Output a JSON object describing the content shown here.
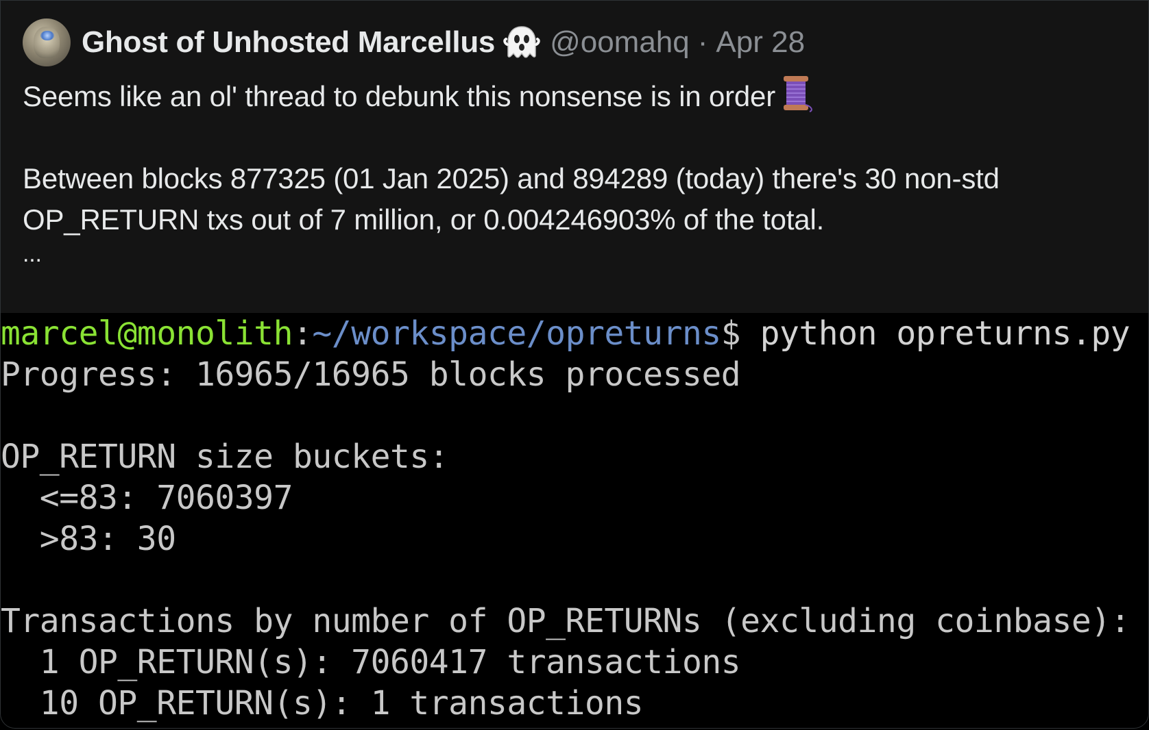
{
  "tweet": {
    "display_name": "Ghost of Unhosted Marcellus",
    "handle": "@oomahq",
    "separator": "·",
    "date": "Apr 28",
    "name_emoji_icon": "ghost-icon",
    "lines": [
      "Seems like an ol' thread to debunk this nonsense is in order",
      "Between blocks 877325 (01 Jan 2025) and 894289 (today) there's 30 non-std",
      "OP_RETURN txs out of 7 million, or 0.004246903% of the total.",
      "..."
    ],
    "line1_emoji_icon": "thread-spool-icon"
  },
  "terminal": {
    "prompt_user": "marcel@monolith",
    "prompt_colon": ":",
    "prompt_path": "~/workspace/opreturns",
    "prompt_dollar": "$",
    "command": " python opreturns.py",
    "output": [
      "Progress: 16965/16965 blocks processed",
      "",
      "OP_RETURN size buckets:",
      "  <=83: 7060397",
      "  >83: 30",
      "",
      "Transactions by number of OP_RETURNs (excluding coinbase):",
      "  1 OP_RETURN(s): 7060417 transactions",
      "  10 OP_RETURN(s): 1 transactions"
    ]
  },
  "colors": {
    "background": "#141414",
    "text": "#e7e9ea",
    "muted": "#8b8f94",
    "terminal_bg": "#000000",
    "prompt_user": "#8ae234",
    "prompt_path": "#6b8ec9",
    "terminal_text": "#c8c8c8"
  }
}
